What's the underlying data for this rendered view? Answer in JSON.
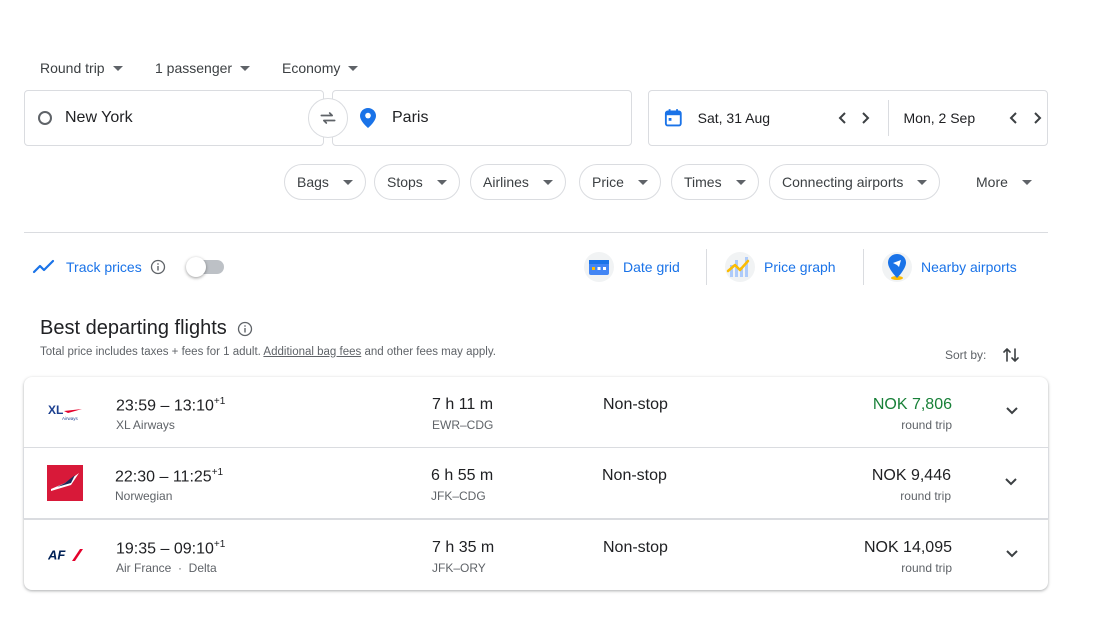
{
  "options": {
    "trip_type": "Round trip",
    "passengers": "1 passenger",
    "cabin": "Economy"
  },
  "search": {
    "origin": "New York",
    "destination": "Paris",
    "depart_date": "Sat, 31 Aug",
    "return_date": "Mon, 2 Sep"
  },
  "filters": [
    "Bags",
    "Stops",
    "Airlines",
    "Price",
    "Times",
    "Connecting airports",
    "More"
  ],
  "tools": {
    "track_prices": "Track prices",
    "date_grid": "Date grid",
    "price_graph": "Price graph",
    "nearby_airports": "Nearby airports"
  },
  "results": {
    "title": "Best departing flights",
    "subtitle_pre": "Total price includes taxes + fees for 1 adult.",
    "subtitle_link": "Additional bag fees",
    "subtitle_post": "and other fees may apply.",
    "sort_label": "Sort by:",
    "flights": [
      {
        "depart": "23:59",
        "arrive": "13:10",
        "day_offset": "+1",
        "airline": "XL Airways",
        "duration": "7 h 11 m",
        "route": "EWR–CDG",
        "stops": "Non-stop",
        "price": "NOK 7,806",
        "price_type": "round trip",
        "price_color": "#188038"
      },
      {
        "depart": "22:30",
        "arrive": "11:25",
        "day_offset": "+1",
        "airline": "Norwegian",
        "duration": "6 h 55 m",
        "route": "JFK–CDG",
        "stops": "Non-stop",
        "price": "NOK 9,446",
        "price_type": "round trip",
        "price_color": "#202124"
      },
      {
        "depart": "19:35",
        "arrive": "09:10",
        "day_offset": "+1",
        "airline": "Air France  ·  Delta",
        "duration": "7 h 35 m",
        "route": "JFK–ORY",
        "stops": "Non-stop",
        "price": "NOK 14,095",
        "price_type": "round trip",
        "price_color": "#202124"
      }
    ]
  },
  "logos": {
    "xl": "XL",
    "xl_sub": "Airways",
    "af": "AF"
  },
  "colors": {
    "accent": "#1a73e8",
    "cheap_price": "#188038",
    "norwegian_red": "#d81939",
    "af_blue": "#002157",
    "af_red": "#e4002b"
  }
}
